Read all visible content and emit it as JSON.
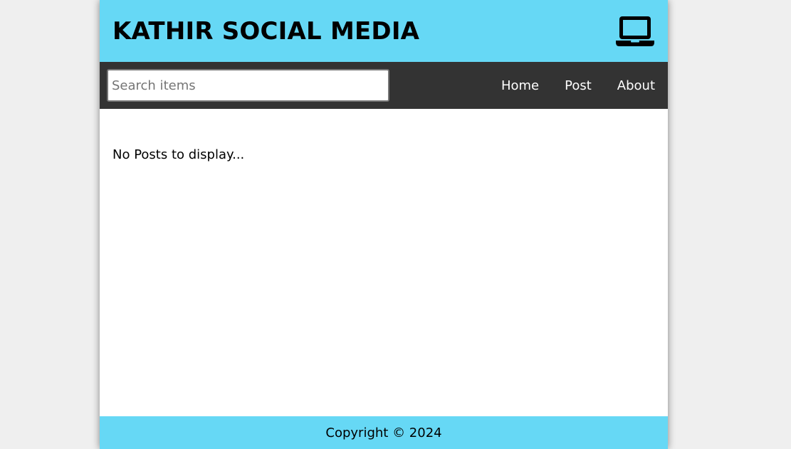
{
  "header": {
    "title": "KATHIR SOCIAL MEDIA",
    "icon": "laptop-icon"
  },
  "nav": {
    "search": {
      "placeholder": "Search items",
      "value": ""
    },
    "links": [
      {
        "label": "Home"
      },
      {
        "label": "Post"
      },
      {
        "label": "About"
      }
    ]
  },
  "main": {
    "status_text": "No Posts to display..."
  },
  "footer": {
    "copyright": "Copyright © 2024"
  },
  "colors": {
    "header_bg": "#66d8f5",
    "nav_bg": "#333333",
    "footer_bg": "#66d8f5",
    "page_bg": "#efefef"
  }
}
